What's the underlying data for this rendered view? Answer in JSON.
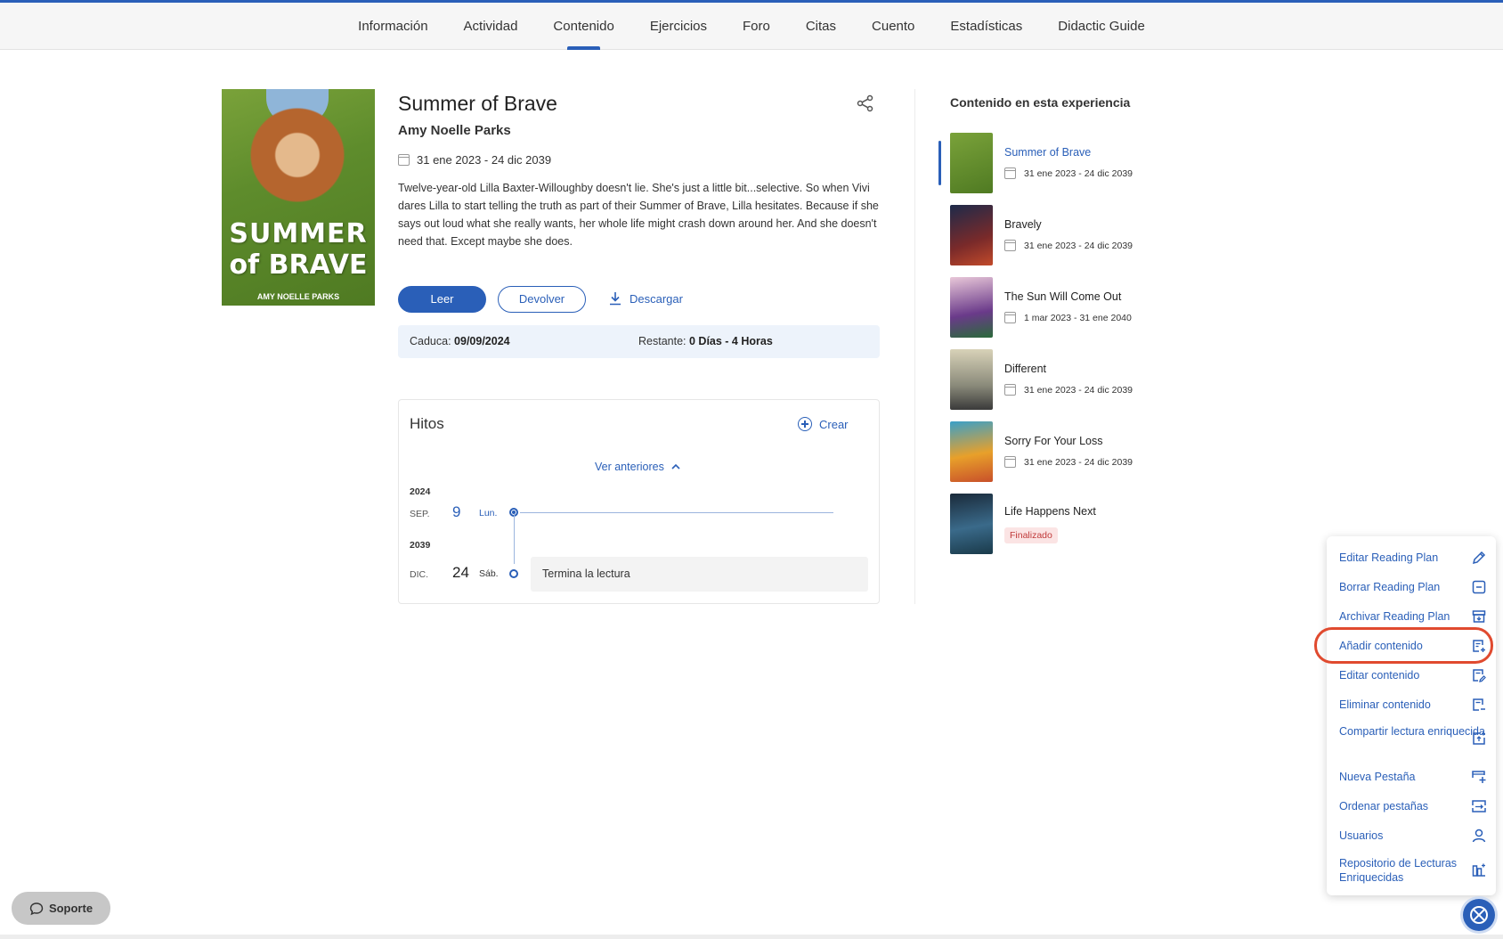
{
  "tabs": [
    {
      "label": "Información"
    },
    {
      "label": "Actividad"
    },
    {
      "label": "Contenido"
    },
    {
      "label": "Ejercicios"
    },
    {
      "label": "Foro"
    },
    {
      "label": "Citas"
    },
    {
      "label": "Cuento"
    },
    {
      "label": "Estadísticas"
    },
    {
      "label": "Didactic Guide"
    }
  ],
  "active_tab": "Contenido",
  "book": {
    "cover_title_1": "SUMMER",
    "cover_title_2": "of BRAVE",
    "cover_author": "AMY NOELLE PARKS",
    "title": "Summer of Brave",
    "author": "Amy Noelle Parks",
    "dates": "31 ene 2023 - 24 dic 2039",
    "description": "Twelve-year-old Lilla Baxter-Willoughby doesn't lie. She's just a little bit...selective. So when Vivi dares Lilla to start telling the truth as part of their Summer of Brave, Lilla hesitates. Because if she says out loud what she really wants, her whole life might crash down around her. And she doesn't need that. Except maybe she does."
  },
  "actions": {
    "read": "Leer",
    "return": "Devolver",
    "download": "Descargar"
  },
  "loan": {
    "expires_label": "Caduca:",
    "expires_value": "09/09/2024",
    "remaining_label": "Restante:",
    "remaining_value": "0 Días - 4 Horas"
  },
  "milestones": {
    "title": "Hitos",
    "create": "Crear",
    "see_previous": "Ver anteriores",
    "entries": [
      {
        "year": "2024",
        "month": "SEP.",
        "day": "9",
        "weekday": "Lun.",
        "text": ""
      },
      {
        "year": "2039",
        "month": "DIC.",
        "day": "24",
        "weekday": "Sáb.",
        "text": "Termina la lectura"
      }
    ]
  },
  "sidebar": {
    "title": "Contenido en esta experiencia",
    "items": [
      {
        "title": "Summer of Brave",
        "date": "31 ene 2023 - 24 dic 2039",
        "active": true
      },
      {
        "title": "Bravely",
        "date": "31 ene 2023 - 24 dic 2039"
      },
      {
        "title": "The Sun Will Come Out",
        "date": "1 mar 2023 - 31 ene 2040"
      },
      {
        "title": "Different",
        "date": "31 ene 2023 - 24 dic 2039"
      },
      {
        "title": "Sorry For Your Loss",
        "date": "31 ene 2023 - 24 dic 2039"
      },
      {
        "title": "Life Happens Next",
        "badge": "Finalizado"
      }
    ]
  },
  "menu": {
    "items": [
      {
        "label": "Editar Reading Plan",
        "icon": "pencil-icon"
      },
      {
        "label": "Borrar Reading Plan",
        "icon": "minus-box-icon"
      },
      {
        "label": "Archivar Reading Plan",
        "icon": "archive-icon"
      },
      {
        "label": "Añadir contenido",
        "icon": "add-content-icon"
      },
      {
        "label": "Editar contenido",
        "icon": "edit-content-icon"
      },
      {
        "label": "Eliminar contenido",
        "icon": "remove-content-icon"
      },
      {
        "label": "Compartir lectura enriquecida",
        "icon": "share-reading-icon"
      },
      {
        "label": "Nueva Pestaña",
        "icon": "new-tab-icon"
      },
      {
        "label": "Ordenar pestañas",
        "icon": "sort-tabs-icon"
      },
      {
        "label": "Usuarios",
        "icon": "user-icon"
      },
      {
        "label": "Repositorio de Lecturas Enriquecidas",
        "icon": "repository-icon"
      }
    ]
  },
  "support": {
    "label": "Soporte"
  },
  "colors": {
    "accent": "#2a5fb8",
    "highlight": "#e04a2f",
    "badge": "#c03a3a"
  }
}
